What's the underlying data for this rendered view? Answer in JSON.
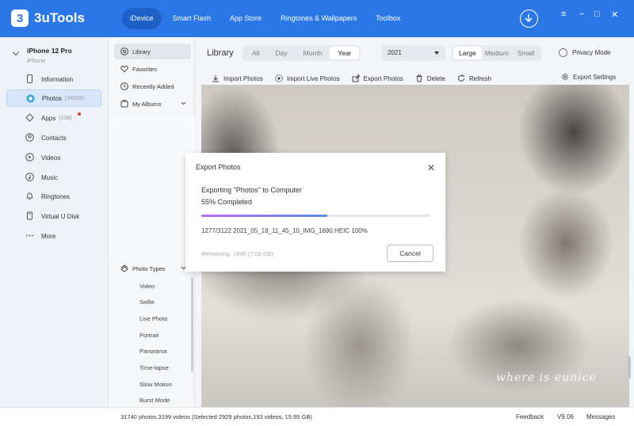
{
  "app": {
    "logo_mark": "3",
    "name": "3uTools"
  },
  "topnav": [
    {
      "label": "iDevice",
      "active": true
    },
    {
      "label": "Smart Flash"
    },
    {
      "label": "App Store"
    },
    {
      "label": "Ringtones & Wallpapers"
    },
    {
      "label": "Toolbox"
    }
  ],
  "window_controls": {
    "menu": "≡",
    "minimize": "−",
    "maximize": "□",
    "close": "✕"
  },
  "device": {
    "name": "iPhone 12 Pro",
    "type": "iPhone"
  },
  "sidebar": {
    "items": [
      {
        "label": "Information",
        "icon": "phone-icon"
      },
      {
        "label": "Photos",
        "count": "(34939)",
        "icon": "photos-icon",
        "active": true
      },
      {
        "label": "Apps",
        "count": "(108)",
        "icon": "apps-icon",
        "badge": true
      },
      {
        "label": "Contacts",
        "icon": "contacts-icon"
      },
      {
        "label": "Videos",
        "icon": "videos-icon"
      },
      {
        "label": "Music",
        "icon": "music-icon"
      },
      {
        "label": "Ringtones",
        "icon": "bell-icon"
      },
      {
        "label": "Virtual U Disk",
        "icon": "udisk-icon"
      },
      {
        "label": "More",
        "icon": "more-icon"
      }
    ]
  },
  "library_panel": {
    "items": [
      {
        "label": "Library",
        "active": true,
        "icon": "library-icon"
      },
      {
        "label": "Favorites",
        "icon": "heart-icon"
      },
      {
        "label": "Recently Added",
        "icon": "clock-icon"
      },
      {
        "label": "My Albums",
        "icon": "album-icon"
      }
    ],
    "photo_types": {
      "label": "Photo Types",
      "items": [
        "Video",
        "Selfie",
        "Live Photo",
        "Portrait",
        "Panorama",
        "Time-lapse",
        "Slow Motion",
        "Burst Mode"
      ]
    }
  },
  "toolbar": {
    "title": "Library",
    "periods": [
      "All",
      "Day",
      "Month",
      "Year"
    ],
    "selected_period": "Year",
    "year": "2021",
    "sizes": [
      "Large",
      "Medium",
      "Small"
    ],
    "selected_size": "Large",
    "privacy_mode": "Privacy Mode",
    "actions": [
      "Import Photos",
      "Import Live Photos",
      "Export Photos",
      "Delete",
      "Refresh"
    ],
    "export_settings": "Export Settings"
  },
  "watermark": "where is eunice",
  "modal": {
    "title": "Export Photos",
    "line1": "Exporting \"Photos\" to Computer",
    "line2": "55% Completed",
    "progress": 0.55,
    "file": "1277/3122 2021_05_18_11_45_10_IMG_1690.HEIC 100%",
    "remaining": "Remaining: 1845 (7.05 GB)",
    "cancel_label": "Cancel"
  },
  "status": {
    "summary": "31740 photos,3199 videos (Selected 2929 photos,193 videos, 15.95 GB)",
    "feedback": "Feedback",
    "version": "V9.06",
    "messages": "Messages"
  },
  "colors": {
    "accent": "#2c77e7",
    "progress_start": "#b86bf0",
    "progress_end": "#5b8de8"
  }
}
